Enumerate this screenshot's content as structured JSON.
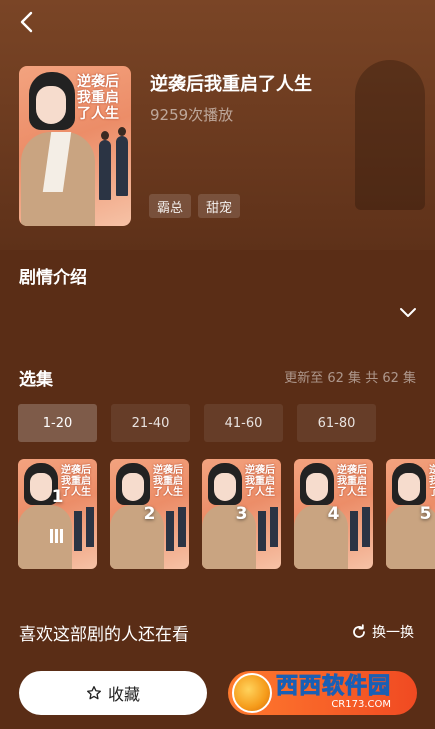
{
  "header": {
    "back_icon": "chevron-left-icon"
  },
  "drama": {
    "title": "逆袭后我重启了人生",
    "plays": "9259次播放",
    "poster_title": "逆袭后我重启了人生",
    "tags": [
      "霸总",
      "甜宠"
    ]
  },
  "synopsis": {
    "title": "剧情介绍",
    "expand_icon": "chevron-down-icon"
  },
  "episodes": {
    "title": "选集",
    "meta": "更新至 62 集 共 62 集",
    "ranges": [
      {
        "label": "1-20",
        "active": true
      },
      {
        "label": "21-40",
        "active": false
      },
      {
        "label": "41-60",
        "active": false
      },
      {
        "label": "61-80",
        "active": false
      }
    ],
    "items": [
      {
        "number": "1",
        "current": true
      },
      {
        "number": "2",
        "current": false
      },
      {
        "number": "3",
        "current": false
      },
      {
        "number": "4",
        "current": false
      },
      {
        "number": "5",
        "current": false
      }
    ],
    "thumb_title": "逆袭后我重启了人生"
  },
  "recommend": {
    "title": "喜欢这部剧的人还在看",
    "refresh_label": "换一换",
    "refresh_icon": "refresh-icon"
  },
  "actions": {
    "favorite_label": "收藏",
    "favorite_icon": "star-outline-icon"
  },
  "watermark": {
    "main": "西西软件园",
    "sub": "CR173.COM"
  },
  "colors": {
    "background": "#5a2d16",
    "accent": "#f04a22"
  }
}
